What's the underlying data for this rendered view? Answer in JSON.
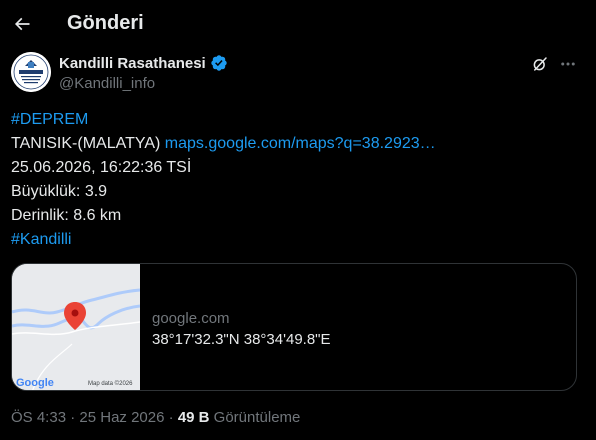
{
  "header": {
    "title": "Gönderi",
    "back_icon": "arrow-left-icon"
  },
  "author": {
    "name": "Kandilli Rasathanesi",
    "handle": "@Kandilli_info",
    "verified": true,
    "verified_color": "#1d9bf0",
    "avatar_text": "KANDILLI"
  },
  "tweet": {
    "hashtag1": "#DEPREM",
    "location": "TANISIK-(MALATYA)",
    "map_link": "maps.google.com/maps?q=38.2923…",
    "datetime": "25.06.2026, 16:22:36 TSİ",
    "magnitude": "Büyüklük: 3.9",
    "depth": "Derinlik: 8.6 km",
    "hashtag2": "#Kandilli"
  },
  "card": {
    "domain": "google.com",
    "title": "38°17'32.3\"N 38°34'49.8\"E",
    "map_logo": "Google",
    "map_credit": "Map data ©2026"
  },
  "meta": {
    "time": "ÖS 4:33",
    "date": "25 Haz 2026",
    "separator": "·",
    "views_count": "49 B",
    "views_label": "Görüntüleme"
  },
  "colors": {
    "background": "#000000",
    "text": "#e7e9ea",
    "muted": "#71767b",
    "link": "#1d9bf0",
    "border": "#2f3336",
    "map_pin": "#ea4335"
  }
}
